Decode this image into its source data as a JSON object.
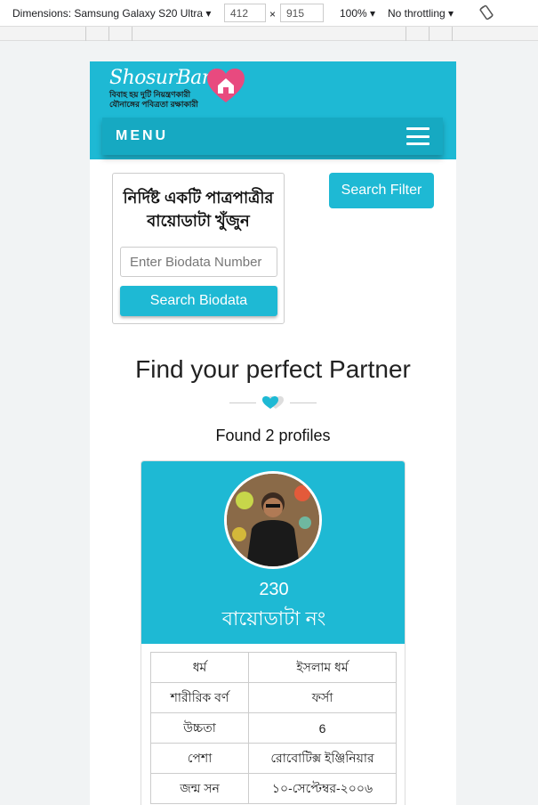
{
  "devtools": {
    "dimensions_label": "Dimensions: Samsung Galaxy S20 Ultra ▾",
    "width": "412",
    "times": "×",
    "height": "915",
    "zoom": "100% ▾",
    "throttle": "No throttling ▾"
  },
  "header": {
    "logo_text": "ShosurBari",
    "tagline1": "বিবাহ হয় দুটি নিয়ন্ত্রণকারী",
    "tagline2": "যৌনাঙ্গের পবিত্রতা রক্ষাকারী",
    "menu_label": "MENU"
  },
  "search": {
    "title": "নির্দিষ্ট একটি পাত্রপাত্রীর বায়োডাটা খুঁজুন",
    "placeholder": "Enter Biodata Number",
    "button": "Search Biodata",
    "filter_button": "Search Filter"
  },
  "section": {
    "title": "Find your perfect Partner",
    "found": "Found 2 profiles"
  },
  "profile": {
    "number": "230",
    "label": "বায়োডাটা নং",
    "rows": [
      {
        "key": "ধর্ম",
        "value": "ইসলাম ধর্ম"
      },
      {
        "key": "শারীরিক বর্ণ",
        "value": "ফর্সা"
      },
      {
        "key": "উচ্চতা",
        "value": "6"
      },
      {
        "key": "পেশা",
        "value": "রোবোটিক্স ইঞ্জিনিয়ার"
      },
      {
        "key": "জন্ম সন",
        "value": "১০-সেপ্টেম্বর-২০০৬"
      }
    ]
  },
  "colors": {
    "accent": "#1eb9d4",
    "heart": "#e84a7f"
  }
}
